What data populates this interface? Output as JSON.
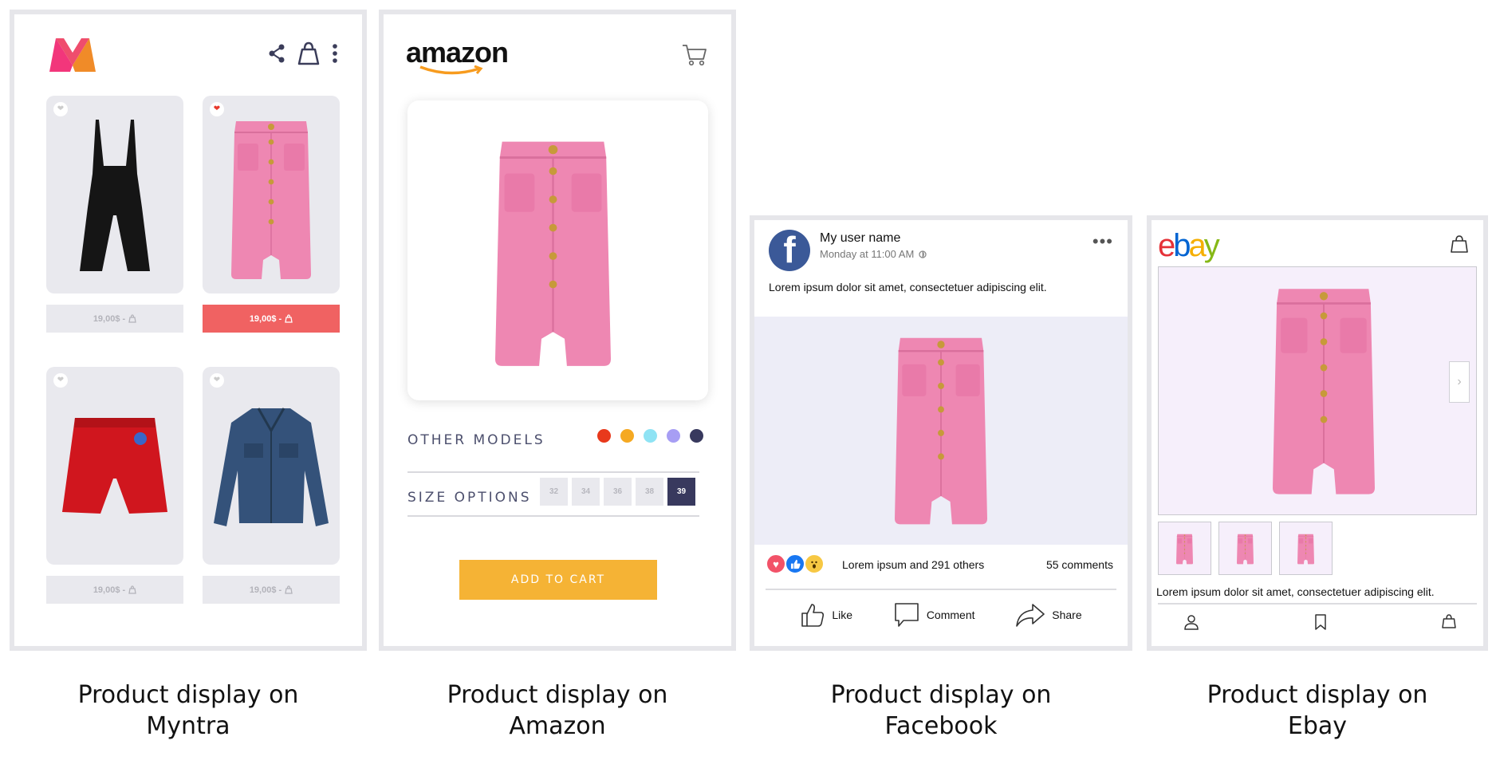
{
  "myntra": {
    "products": [
      {
        "price": "19,00$ -",
        "favorite": false
      },
      {
        "price": "19,00$ -",
        "favorite": true
      },
      {
        "price": "19,00$ -",
        "favorite": false
      },
      {
        "price": "19,00$ -",
        "favorite": false
      }
    ]
  },
  "amazon": {
    "logo": "amazon",
    "other_models_label": "OTHER MODELS",
    "color_options": [
      "#e8391c",
      "#f5a922",
      "#8fe3f4",
      "#a79ef4",
      "#38395e"
    ],
    "size_options_label": "SIZE OPTIONS",
    "sizes": [
      {
        "label": "32",
        "selected": false
      },
      {
        "label": "34",
        "selected": false
      },
      {
        "label": "36",
        "selected": false
      },
      {
        "label": "38",
        "selected": false
      },
      {
        "label": "39",
        "selected": true
      }
    ],
    "add_to_cart": "ADD TO CART"
  },
  "facebook": {
    "avatar_letter": "f",
    "user_name": "My user name",
    "timestamp": "Monday at 11:00 AM",
    "post_text": "Lorem ipsum dolor sit amet, consectetuer adipiscing elit.",
    "reactions_text": "Lorem ipsum and  291 others",
    "comments": "55 comments",
    "actions": {
      "like": "Like",
      "comment": "Comment",
      "share": "Share"
    }
  },
  "ebay": {
    "logo": [
      "e",
      "b",
      "a",
      "y"
    ],
    "logo_colors": [
      "#e53238",
      "#0064d2",
      "#f5af02",
      "#86b817"
    ],
    "description": "Lorem ipsum dolor sit amet, consectetuer adipiscing elit."
  },
  "captions": {
    "myntra": [
      "Product display on",
      "Myntra"
    ],
    "amazon": [
      "Product display on",
      "Amazon"
    ],
    "facebook": [
      "Product display on",
      "Facebook"
    ],
    "ebay": [
      "Product display on",
      "Ebay"
    ]
  },
  "colors": {
    "frame_border": "#e6e6ea",
    "myntra_active_price": "#f06262",
    "amazon_button": "#f5b335",
    "amazon_selected_size": "#38395e",
    "facebook_blue": "#3b5998"
  }
}
